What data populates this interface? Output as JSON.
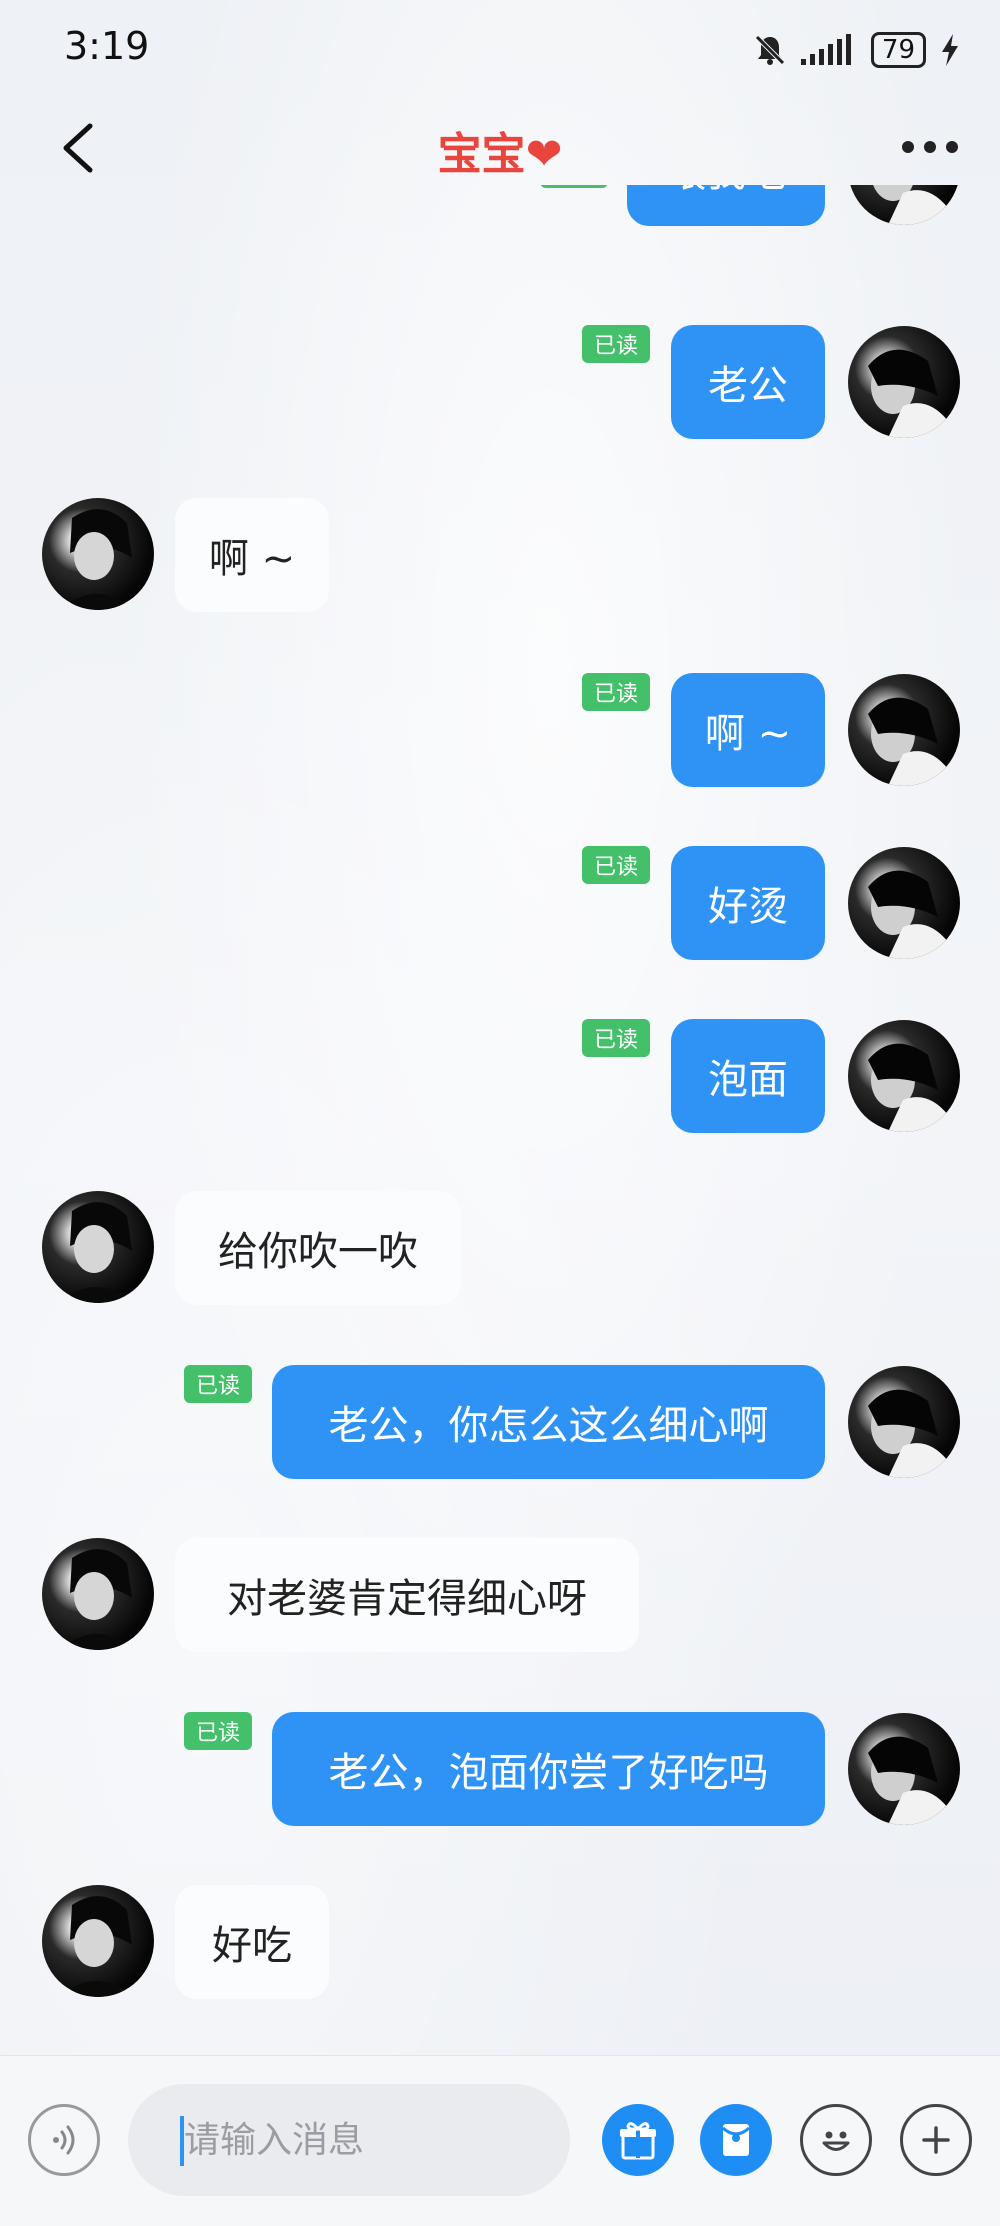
{
  "status_bar": {
    "time": "3:19",
    "battery": "79"
  },
  "header": {
    "title": "宝宝",
    "heart": "❤"
  },
  "messages": [
    {
      "side": "me",
      "text": "喂我吃"
    },
    {
      "side": "me",
      "text": "老公",
      "read": "已读"
    },
    {
      "side": "them",
      "text": "啊 ~"
    },
    {
      "side": "me",
      "text": "啊 ~",
      "read": "已读"
    },
    {
      "side": "me",
      "text": "好烫",
      "read": "已读"
    },
    {
      "side": "me",
      "text": "泡面",
      "read": "已读"
    },
    {
      "side": "them",
      "text": "给你吹一吹"
    },
    {
      "side": "me",
      "text": "老公，你怎么这么细心啊",
      "read": "已读"
    },
    {
      "side": "them",
      "text": "对老婆肯定得细心呀"
    },
    {
      "side": "me",
      "text": "老公，泡面你尝了好吃吗",
      "read": "已读"
    },
    {
      "side": "them",
      "text": "好吃"
    }
  ],
  "input": {
    "placeholder": "请输入消息"
  },
  "icons": {
    "back": "chevron-left-icon",
    "more": "more-dots-icon",
    "mute": "bell-off-icon",
    "voice": "voice-icon",
    "gift": "gift-icon",
    "envelope": "envelope-icon",
    "emoji": "emoji-icon",
    "plus": "plus-icon"
  },
  "colors": {
    "accent": "#2e93f5",
    "title": "#e8453c",
    "read_badge": "#44c06a"
  }
}
